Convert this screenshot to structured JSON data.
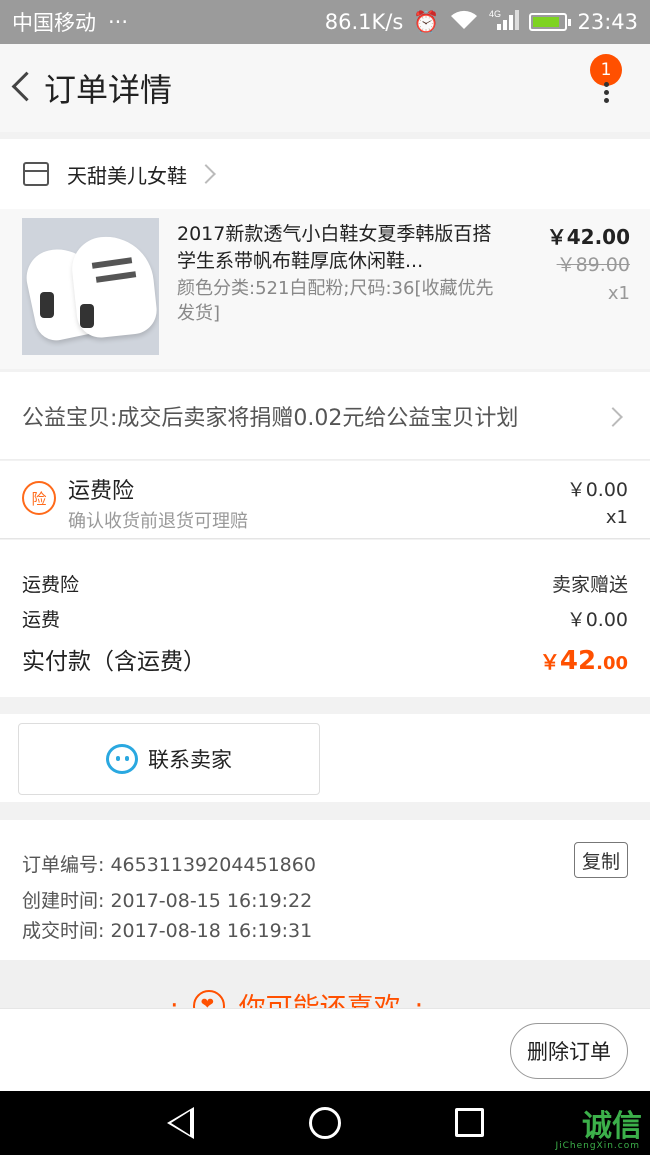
{
  "status_bar": {
    "carrier": "中国移动",
    "dots": "···",
    "speed": "86.1K/s",
    "network": "4G",
    "time": "23:43"
  },
  "header": {
    "title": "订单详情",
    "badge_count": "1"
  },
  "shop": {
    "name": "天甜美儿女鞋"
  },
  "product": {
    "title": "2017新款透气小白鞋女夏季韩版百搭学生系带帆布鞋厚底休闲鞋...",
    "sku": "颜色分类:521白配粉;尺码:36[收藏优先发货]",
    "price": "￥42.00",
    "original_price": "￥89.00",
    "quantity": "x1"
  },
  "charity": {
    "text": "公益宝贝:成交后卖家将捐赠0.02元给公益宝贝计划"
  },
  "insurance": {
    "icon_char": "险",
    "title": "运费险",
    "desc": "确认收货前退货可理赔",
    "price": "￥0.00",
    "quantity": "x1"
  },
  "summary": {
    "freight_insurance_label": "运费险",
    "freight_insurance_value": "卖家赠送",
    "shipping_label": "运费",
    "shipping_value": "￥0.00",
    "total_label": "实付款（含运费）",
    "total_currency": "￥",
    "total_integer": "42",
    "total_decimal": ".00"
  },
  "contact": {
    "label": "联系卖家"
  },
  "order_info": {
    "order_no": "订单编号: 46531139204451860",
    "created": "创建时间: 2017-08-15 16:19:22",
    "completed": "成交时间: 2017-08-18 16:19:31",
    "copy_label": "复制"
  },
  "recommend": {
    "title": "你可能还喜欢"
  },
  "bottom": {
    "delete_label": "删除订单"
  },
  "watermark": {
    "text": "诚信",
    "sub": "JiChengXin.com"
  },
  "colors": {
    "accent": "#ff5000",
    "status_bar": "#9b9b9b",
    "chat_blue": "#2aa8e0"
  }
}
